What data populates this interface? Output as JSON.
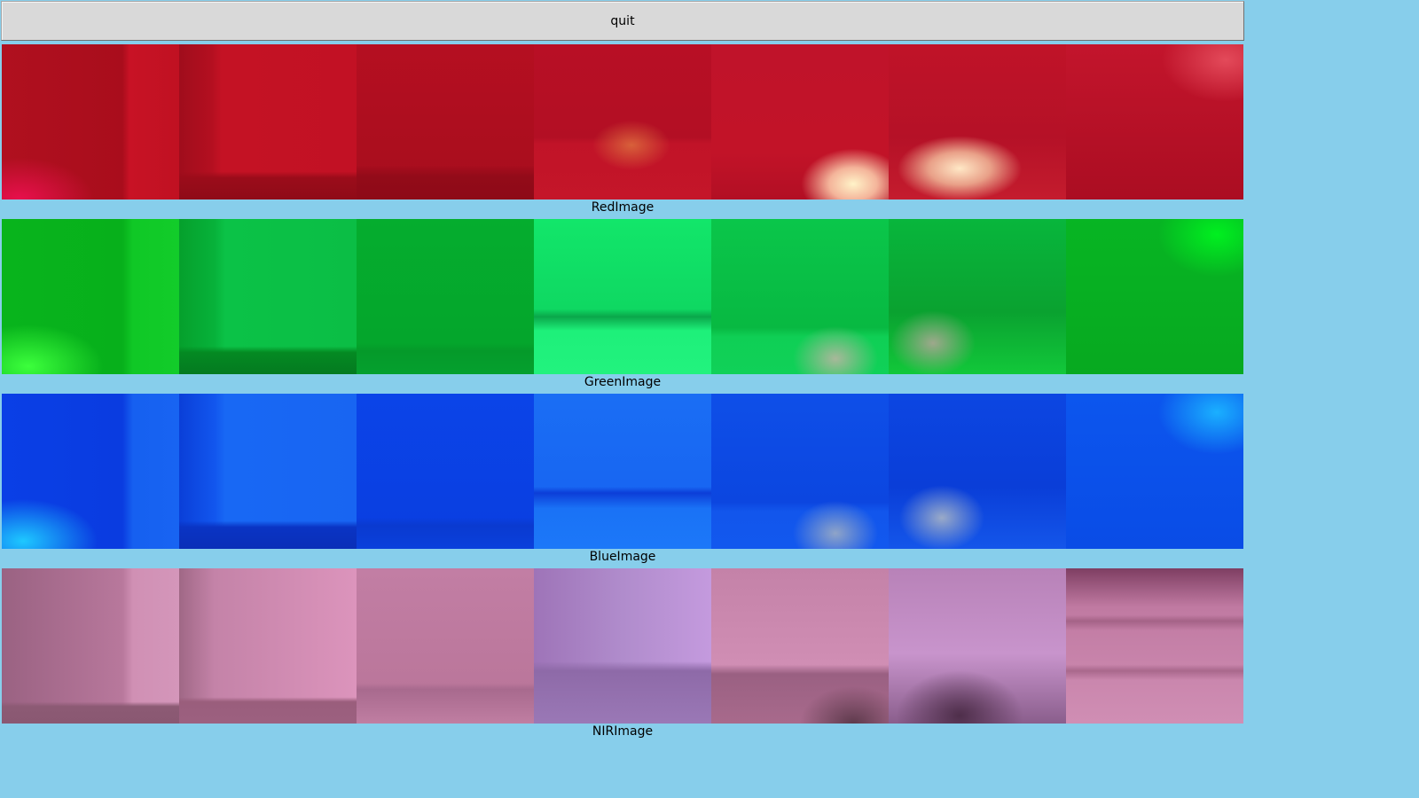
{
  "window": {
    "background_color": "#87ceeb"
  },
  "toolbar": {
    "quit_label": "quit"
  },
  "strips": [
    {
      "id": "red",
      "label": "RedImage",
      "tile_count": 7
    },
    {
      "id": "green",
      "label": "GreenImage",
      "tile_count": 7
    },
    {
      "id": "blue",
      "label": "BlueImage",
      "tile_count": 7
    },
    {
      "id": "nir",
      "label": "NIRImage",
      "tile_count": 7
    }
  ]
}
